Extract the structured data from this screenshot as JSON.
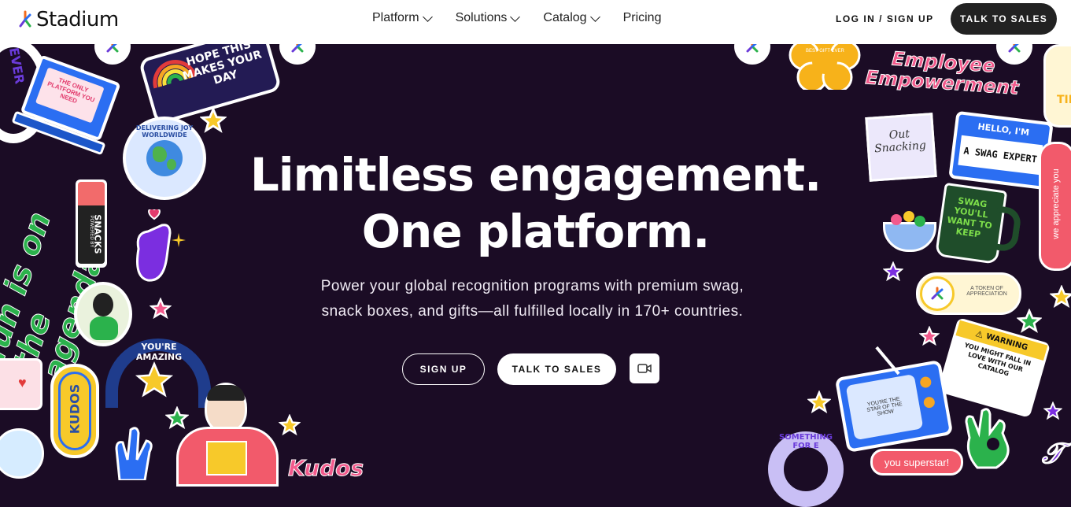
{
  "header": {
    "logo_text": "Stadium",
    "nav": [
      {
        "label": "Platform",
        "has_dropdown": true
      },
      {
        "label": "Solutions",
        "has_dropdown": true
      },
      {
        "label": "Catalog",
        "has_dropdown": true
      },
      {
        "label": "Pricing",
        "has_dropdown": false
      }
    ],
    "login_label": "LOG IN / SIGN UP",
    "talk_label": "TALK TO SALES"
  },
  "hero": {
    "title_line1": "Limitless engagement.",
    "title_line2": "One platform.",
    "subtitle_line1": "Power your global recognition programs with premium swag,",
    "subtitle_line2": "snack boxes, and gifts—all fulfilled locally in 170+ countries.",
    "signup_label": "SIGN UP",
    "talk_label": "TALK TO SALES",
    "video_icon": "video-camera-icon"
  },
  "stickers": {
    "hope": "HOPE THIS MAKES YOUR DAY",
    "laptop": "THE ONLY PLATFORM YOU NEED",
    "delivering": "DELIVERING JOY WORLDWIDE",
    "snacks": "SNACKS",
    "snacks_small": "POWERED BY",
    "fun": "fun is on the agenda",
    "amazing": "YOU'RE AMAZING",
    "kudos": "KUDOS",
    "kudos_script": "Kudos",
    "employee": "Employee Empowerment",
    "out_snacking": "Out Snacking",
    "hello": "HELLO, I'M",
    "swag_expert": "A SWAG EXPERT",
    "swag_mug": "SWAG YOU'LL WANT TO KEEP",
    "appreciate": "we appreciate you",
    "token": "A TOKEN OF APPRECIATION",
    "warning": "WARNING",
    "warning_body": "YOU MIGHT FALL IN LOVE WITH OUR CATALOG",
    "star_show": "YOU'RE THE STAR OF THE SHOW",
    "superstar": "you superstar!",
    "something": "SOMETHING FOR E",
    "ever": "EVER",
    "tim": "TIM",
    "best_gift": "BEST GIFT EVER"
  },
  "colors": {
    "background": "#1b0c25",
    "header_bg": "#ffffff",
    "dark_button": "#222222",
    "brand_orange": "#f26b1d",
    "brand_purple": "#6a3bd9",
    "brand_blue": "#2b6ef2",
    "brand_green": "#2bb24c"
  }
}
